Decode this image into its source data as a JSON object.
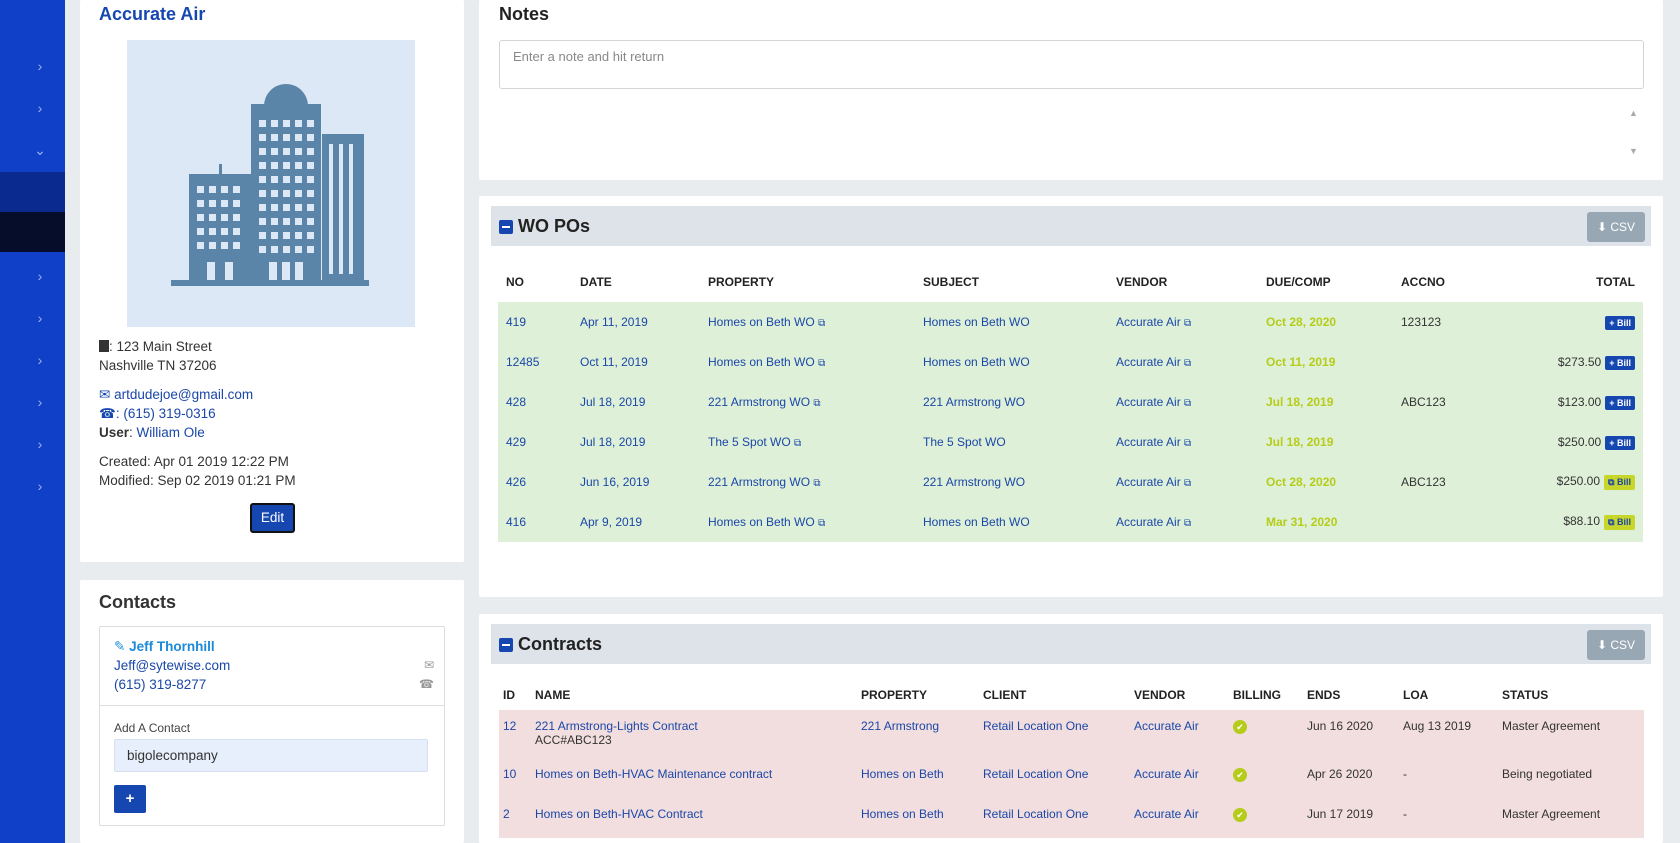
{
  "company": {
    "name": "Accurate Air",
    "address_line1": ": 123 Main Street",
    "address_line2": "Nashville TN 37206",
    "email": "artdudejoe@gmail.com",
    "phone": ": (615) 319-0316",
    "user_label": "User",
    "user_name": "William Ole",
    "created": "Created: Apr 01 2019 12:22 PM",
    "modified": "Modified: Sep 02 2019 01:21 PM",
    "edit_label": "Edit"
  },
  "contacts": {
    "title": "Contacts",
    "contact_name": "Jeff Thornhill",
    "contact_email": "Jeff@sytewise.com",
    "contact_phone": "(615) 319-8277",
    "add_label": "Add A Contact",
    "add_value": "bigolecompany",
    "plus_label": "+"
  },
  "notes": {
    "title": "Notes",
    "placeholder": "Enter a note and hit return"
  },
  "wo_pos": {
    "title": "WO POs",
    "csv_label": "CSV",
    "columns": [
      "NO",
      "DATE",
      "PROPERTY",
      "SUBJECT",
      "VENDOR",
      "DUE/COMP",
      "ACCNO",
      "TOTAL"
    ],
    "bill_label": "Bill",
    "rows": [
      {
        "no": "419",
        "date": "Apr 11, 2019",
        "property": "Homes on Beth WO",
        "subject": "Homes on Beth WO",
        "vendor": "Accurate Air",
        "due": "Oct 28, 2020",
        "accno": "123123",
        "total": ""
      },
      {
        "no": "12485",
        "date": "Oct 11, 2019",
        "property": "Homes on Beth WO",
        "subject": "Homes on Beth WO",
        "vendor": "Accurate Air",
        "due": "Oct 11, 2019",
        "accno": "",
        "total": "$273.50"
      },
      {
        "no": "428",
        "date": "Jul 18, 2019",
        "property": "221 Armstrong WO",
        "subject": "221 Armstrong WO",
        "vendor": "Accurate Air",
        "due": "Jul 18, 2019",
        "accno": "ABC123",
        "total": "$123.00"
      },
      {
        "no": "429",
        "date": "Jul 18, 2019",
        "property": "The 5 Spot WO",
        "subject": "The 5 Spot WO",
        "vendor": "Accurate Air",
        "due": "Jul 18, 2019",
        "accno": "",
        "total": "$250.00"
      },
      {
        "no": "426",
        "date": "Jun 16, 2019",
        "property": "221 Armstrong WO",
        "subject": "221 Armstrong WO",
        "vendor": "Accurate Air",
        "due": "Oct 28, 2020",
        "accno": "ABC123",
        "total": "$250.00"
      },
      {
        "no": "416",
        "date": "Apr 9, 2019",
        "property": "Homes on Beth WO",
        "subject": "Homes on Beth WO",
        "vendor": "Accurate Air",
        "due": "Mar 31, 2020",
        "accno": "",
        "total": "$88.10"
      }
    ]
  },
  "contracts": {
    "title": "Contracts",
    "csv_label": "CSV",
    "columns": [
      "ID",
      "NAME",
      "PROPERTY",
      "CLIENT",
      "VENDOR",
      "BILLING",
      "ENDS",
      "LOA",
      "STATUS"
    ],
    "rows": [
      {
        "id": "12",
        "name": "221 Armstrong-Lights Contract",
        "sub": "ACC#ABC123",
        "property": "221 Armstrong",
        "client": "Retail Location One",
        "vendor": "Accurate Air",
        "ends": "Jun 16 2020",
        "loa": "Aug 13 2019",
        "status": "Master Agreement"
      },
      {
        "id": "10",
        "name": "Homes on Beth-HVAC Maintenance contract",
        "sub": "",
        "property": "Homes on Beth",
        "client": "Retail Location One",
        "vendor": "Accurate Air",
        "ends": "Apr 26 2020",
        "loa": "-",
        "status": "Being negotiated"
      },
      {
        "id": "2",
        "name": "Homes on Beth-HVAC Contract",
        "sub": "",
        "property": "Homes on Beth",
        "client": "Retail Location One",
        "vendor": "Accurate Air",
        "ends": "Jun 17 2019",
        "loa": "-",
        "status": "Master Agreement"
      }
    ]
  },
  "colors": {
    "sidebar": "#1040c8",
    "accent": "#1647b0",
    "row_green": "#dff0d8",
    "row_red": "#f2dede",
    "due_yellow": "#b5cc18"
  }
}
